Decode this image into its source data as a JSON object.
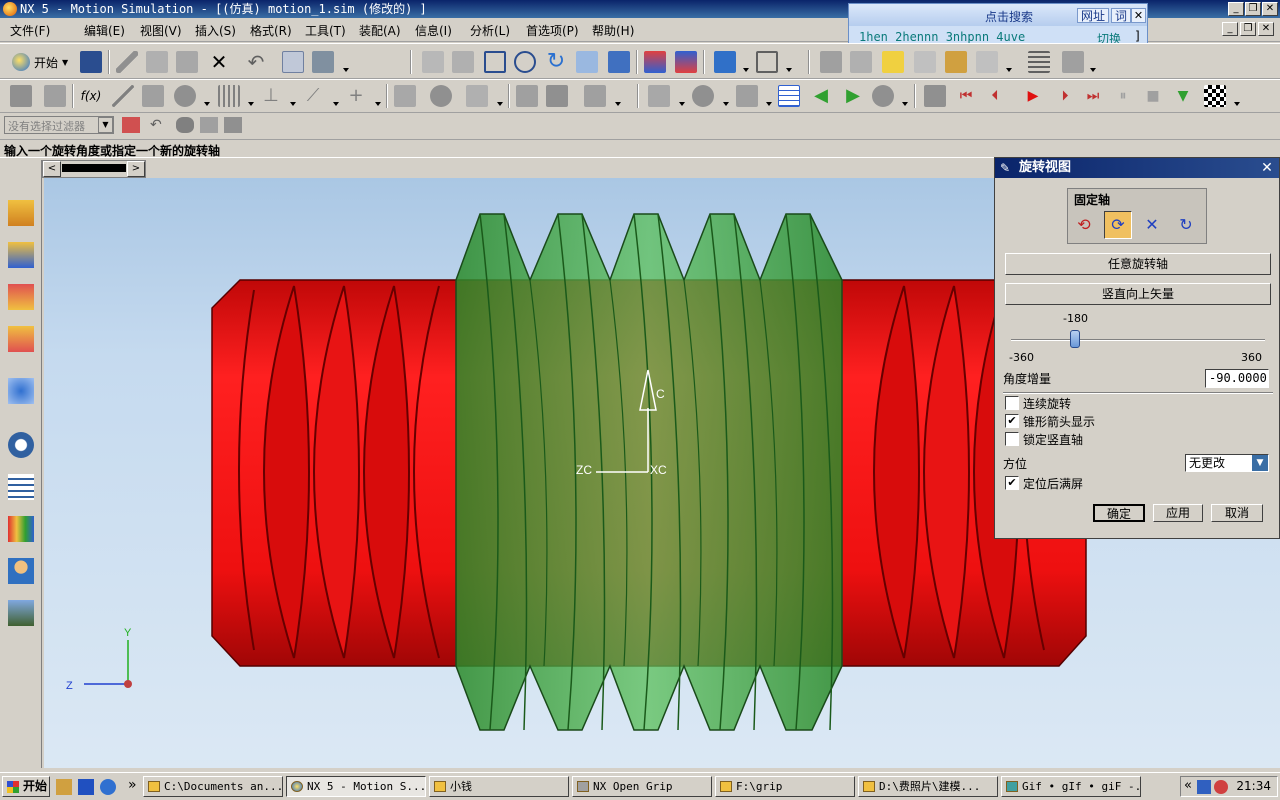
{
  "window": {
    "title": "NX 5 - Motion Simulation - [(仿真) motion_1.sim (修改的) ]"
  },
  "menu": {
    "items": [
      "文件(F)",
      "编辑(E)",
      "视图(V)",
      "插入(S)",
      "格式(R)",
      "工具(T)",
      "装配(A)",
      "信息(I)",
      "分析(L)",
      "首选项(P)",
      "帮助(H)"
    ]
  },
  "search_panel": {
    "label": "点击搜索",
    "buttons": [
      "网址",
      "词"
    ],
    "close": "✕",
    "options": "1hen 2hennn 3nhpnn 4uve",
    "switch_label": "切换",
    "bracket": "]"
  },
  "toolbar": {
    "start_label": "开始"
  },
  "filter": {
    "placeholder": "没有选择过滤器"
  },
  "prompt": {
    "text": "输入一个旋转角度或指定一个新的旋转轴"
  },
  "viewport": {
    "triad": {
      "y": "Y",
      "z": "Z"
    },
    "wcs": {
      "c": "C",
      "zc": "ZC",
      "xc": "XC"
    }
  },
  "dialog": {
    "title": "旋转视图",
    "fixed_axis_label": "固定轴",
    "axis_buttons": [
      "⟲",
      "⟳",
      "✕",
      "↻"
    ],
    "arbitrary_axis_btn": "任意旋转轴",
    "vertical_vector_btn": "竖直向上矢量",
    "slider": {
      "value": "-180",
      "min": "-360",
      "max": "360",
      "position": -180
    },
    "angle_increment_label": "角度增量",
    "angle_increment_value": "-90.0000",
    "checkboxes": [
      {
        "label": "连续旋转",
        "checked": false
      },
      {
        "label": "锥形箭头显示",
        "checked": true
      },
      {
        "label": "锁定竖直轴",
        "checked": false
      }
    ],
    "orientation_label": "方位",
    "orientation_value": "无更改",
    "fit_after_label": "定位后满屏",
    "fit_after_checked": true,
    "ok_btn": "确定",
    "apply_btn": "应用",
    "cancel_btn": "取消"
  },
  "taskbar": {
    "start": "开始",
    "chevron": "»",
    "tasks": [
      "C:\\Documents an...",
      "NX 5 - Motion S...",
      "小钱",
      "NX Open Grip",
      "F:\\grip",
      "D:\\费照片\\建模...",
      "Gif • gIf • giF -..."
    ],
    "tray_chevron": "«",
    "clock": "21:34"
  },
  "colors": {
    "worm_wheel": "#ee1010",
    "worm": "#3aa83a",
    "title_bar": "#0a246a"
  }
}
